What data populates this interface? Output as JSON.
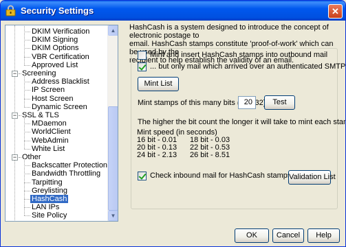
{
  "window": {
    "title": "Security Settings",
    "close_glyph": "✕",
    "colors": {
      "titlebar": "#0058ee",
      "selection": "#316ac5",
      "face": "#ece9d8"
    }
  },
  "tree": {
    "items": [
      {
        "label": "DKIM Verification",
        "kind": "child"
      },
      {
        "label": "DKIM Signing",
        "kind": "child"
      },
      {
        "label": "DKIM Options",
        "kind": "child"
      },
      {
        "label": "VBR Certification",
        "kind": "child"
      },
      {
        "label": "Approved List",
        "kind": "child"
      },
      {
        "label": "Screening",
        "kind": "group",
        "expander": "−"
      },
      {
        "label": "Address Blacklist",
        "kind": "child"
      },
      {
        "label": "IP Screen",
        "kind": "child"
      },
      {
        "label": "Host Screen",
        "kind": "child"
      },
      {
        "label": "Dynamic Screen",
        "kind": "child"
      },
      {
        "label": "SSL & TLS",
        "kind": "group",
        "expander": "−"
      },
      {
        "label": "MDaemon",
        "kind": "child"
      },
      {
        "label": "WorldClient",
        "kind": "child"
      },
      {
        "label": "WebAdmin",
        "kind": "child"
      },
      {
        "label": "White List",
        "kind": "child"
      },
      {
        "label": "Other",
        "kind": "group",
        "expander": "−"
      },
      {
        "label": "Backscatter Protection",
        "kind": "child"
      },
      {
        "label": "Bandwidth Throttling",
        "kind": "child"
      },
      {
        "label": "Tarpitting",
        "kind": "child"
      },
      {
        "label": "Greylisting",
        "kind": "child"
      },
      {
        "label": "HashCash",
        "kind": "child",
        "selected": true
      },
      {
        "label": "LAN IPs",
        "kind": "child"
      },
      {
        "label": "Site Policy",
        "kind": "child"
      }
    ],
    "scroll_up": "▲",
    "scroll_down": "▼"
  },
  "hashcash": {
    "description_lines": [
      "HashCash is a system designed to introduce the concept of electronic postage to",
      "email.  HashCash stamps constitute 'proof-of-work' which can be used by the",
      "recipient to help establish the validity of an email."
    ],
    "mint_outbound": {
      "label": "Mint and insert HashCash stamps into outbound mail",
      "checked": false
    },
    "only_auth": {
      "label": "... but only mail which arrived over an authenticated SMTP session",
      "checked": true
    },
    "mint_list_button": "Mint List",
    "bits_label": "Mint stamps of this many bits (10 - 32)",
    "bits_value": "20",
    "test_button": "Test",
    "note": "The higher the bit count the longer it will take to mint each stamp.",
    "speed_header": "Mint speed (in seconds)",
    "speeds": [
      [
        "16 bit - 0.01",
        "18 bit - 0.03"
      ],
      [
        "20 bit - 0.13",
        "22 bit - 0.53"
      ],
      [
        "24 bit - 2.13",
        "26 bit - 8.51"
      ]
    ],
    "check_inbound": {
      "label": "Check inbound mail for HashCash stamps",
      "checked": true
    },
    "validation_list_button": "Validation List"
  },
  "footer": {
    "ok": "OK",
    "cancel": "Cancel",
    "help": "Help"
  }
}
